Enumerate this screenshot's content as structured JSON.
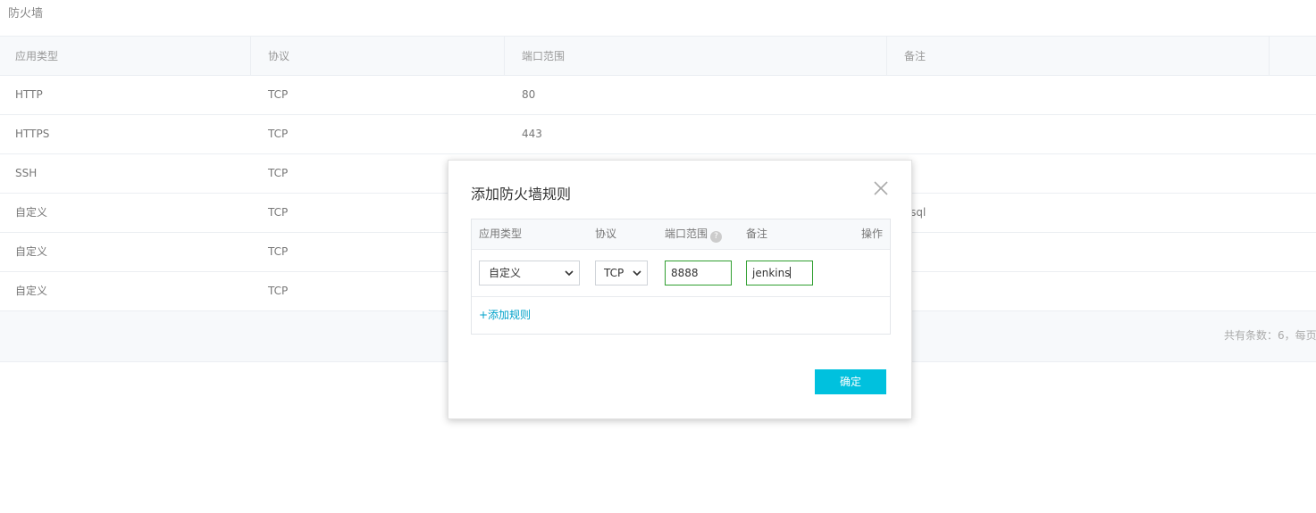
{
  "page": {
    "title": "防火墙"
  },
  "table": {
    "columns": [
      "应用类型",
      "协议",
      "端口范围",
      "备注",
      ""
    ],
    "rows": [
      {
        "type": "HTTP",
        "protocol": "TCP",
        "port": "80",
        "note": ""
      },
      {
        "type": "HTTPS",
        "protocol": "TCP",
        "port": "443",
        "note": ""
      },
      {
        "type": "SSH",
        "protocol": "TCP",
        "port": "",
        "note": ""
      },
      {
        "type": "自定义",
        "protocol": "TCP",
        "port": "",
        "note": "ysql"
      },
      {
        "type": "自定义",
        "protocol": "TCP",
        "port": "",
        "note": ""
      },
      {
        "type": "自定义",
        "protocol": "TCP",
        "port": "",
        "note": ""
      }
    ],
    "footer": {
      "summary": "共有条数：6，每页"
    }
  },
  "dialog": {
    "title": "添加防火墙规则",
    "columns": {
      "type": "应用类型",
      "protocol": "协议",
      "port": "端口范围",
      "help": "?",
      "note": "备注",
      "action": "操作"
    },
    "rule": {
      "type": "自定义",
      "protocol": "TCP",
      "port": "8888",
      "note": "jenkins"
    },
    "add_rule_label": "+添加规则",
    "ok_label": "确定"
  },
  "colors": {
    "accent": "#00c1de",
    "link": "#00a2ca",
    "focus_border": "#2f9e2f"
  },
  "icons": {
    "close": "close-icon",
    "help": "question-circle-icon",
    "dropdown": "chevron-down-icon"
  }
}
